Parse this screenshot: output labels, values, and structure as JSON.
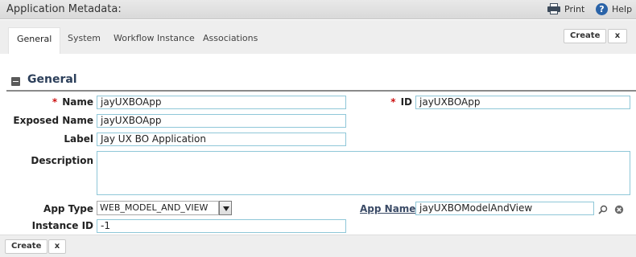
{
  "header": {
    "title": "Application Metadata:",
    "print_label": "Print",
    "help_label": "Help",
    "print_icon": "printer-icon",
    "help_icon": "help-icon"
  },
  "tabs": [
    {
      "label": "General",
      "active": true
    },
    {
      "label": "System",
      "active": false
    },
    {
      "label": "Workflow Instance",
      "active": false
    },
    {
      "label": "Associations",
      "active": false
    }
  ],
  "toolbar": {
    "create_label": "Create",
    "close_label": "x"
  },
  "section": {
    "title": "General",
    "collapse_icon": "minus-icon"
  },
  "form": {
    "name": {
      "label": "Name",
      "value": "jayUXBOApp",
      "required": true
    },
    "id": {
      "label": "ID",
      "value": "jayUXBOApp",
      "required": true
    },
    "exposed_name": {
      "label": "Exposed Name",
      "value": "jayUXBOApp"
    },
    "label": {
      "label": "Label",
      "value": "Jay UX BO Application"
    },
    "description": {
      "label": "Description",
      "value": ""
    },
    "app_type": {
      "label": "App Type",
      "value": "WEB_MODEL_AND_VIEW"
    },
    "app_name": {
      "label": "App Name",
      "value": "jayUXBOModelAndView",
      "search_icon": "search-icon",
      "clear_icon": "clear-icon"
    },
    "instance_id": {
      "label": "Instance ID",
      "value": "-1"
    }
  },
  "footer": {
    "create_label": "Create",
    "close_label": "x"
  },
  "required_marker": "*",
  "colors": {
    "accent": "#2c3f5a",
    "field_border": "#8fc7d8",
    "required": "#cc1111"
  }
}
